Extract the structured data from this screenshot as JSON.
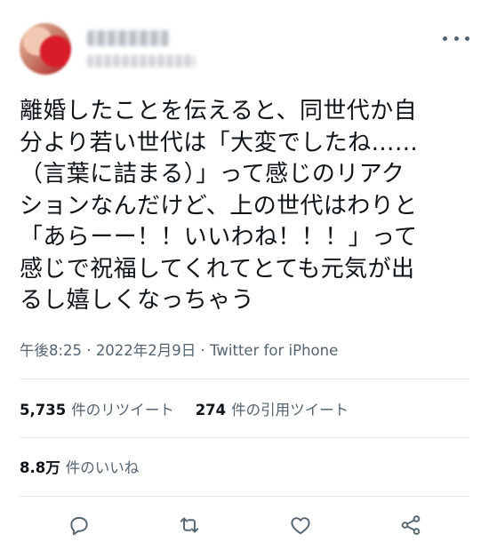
{
  "tweet": {
    "text_lines": [
      "離婚したことを伝えると、同世代か自",
      "分より若い世代は「大変でしたね……",
      "（言葉に詰まる）」って感じのリアク",
      "ションなんだけど、上の世代はわりと",
      "「あらーー！！いいわね！！！」って",
      "感じで祝福してくれてとても元気が出",
      "るし嬉しくなっちゃう"
    ],
    "time": "午後8:25",
    "date": "2022年2月9日",
    "separator": " · ",
    "source": "Twitter for iPhone"
  },
  "stats": {
    "retweets_count": "5,735",
    "retweets_label": "件のリツイート",
    "quotes_count": "274",
    "quotes_label": "件の引用ツイート",
    "likes_count": "8.8万",
    "likes_label": "件のいいね"
  },
  "icons": {
    "more": "more-dots-icon",
    "reply": "reply-icon",
    "retweet": "retweet-icon",
    "like": "like-icon",
    "share": "share-icon"
  },
  "colors": {
    "text": "#0f1419",
    "secondary": "#536471",
    "divider": "#e4e7ea"
  }
}
